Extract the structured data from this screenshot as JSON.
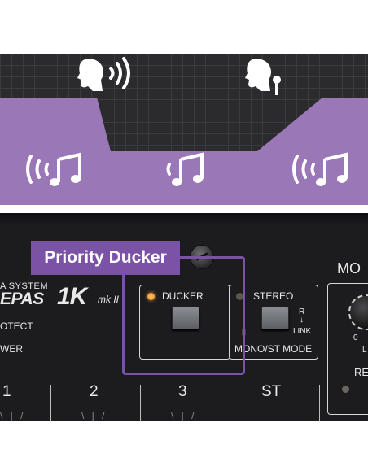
{
  "callout": {
    "label": "Priority Ducker"
  },
  "panel": {
    "brand_system": "A SYSTEM",
    "brand_main": "EPAS",
    "brand_model": "1K",
    "brand_mk": "mk II",
    "protect_label": "OTECT",
    "power_label": "WER",
    "ducker": {
      "label": "DUCKER",
      "led_state": "on"
    },
    "stereo": {
      "label": "STEREO",
      "r_label": "R",
      "arrow": "↓",
      "link_label": "LINK",
      "mode_label": "MONO/ST MODE",
      "led_state": "off"
    },
    "mode_label": "MO",
    "knob_zero": "0",
    "knob_l": "L",
    "re_label": "RE",
    "channels": [
      "1",
      "2",
      "3",
      "ST"
    ]
  },
  "colors": {
    "accent_purple": "#7a53a6",
    "music_band": "#9a77b7",
    "grid_bg": "#2b2b2d",
    "led_orange": "#f0a030"
  }
}
